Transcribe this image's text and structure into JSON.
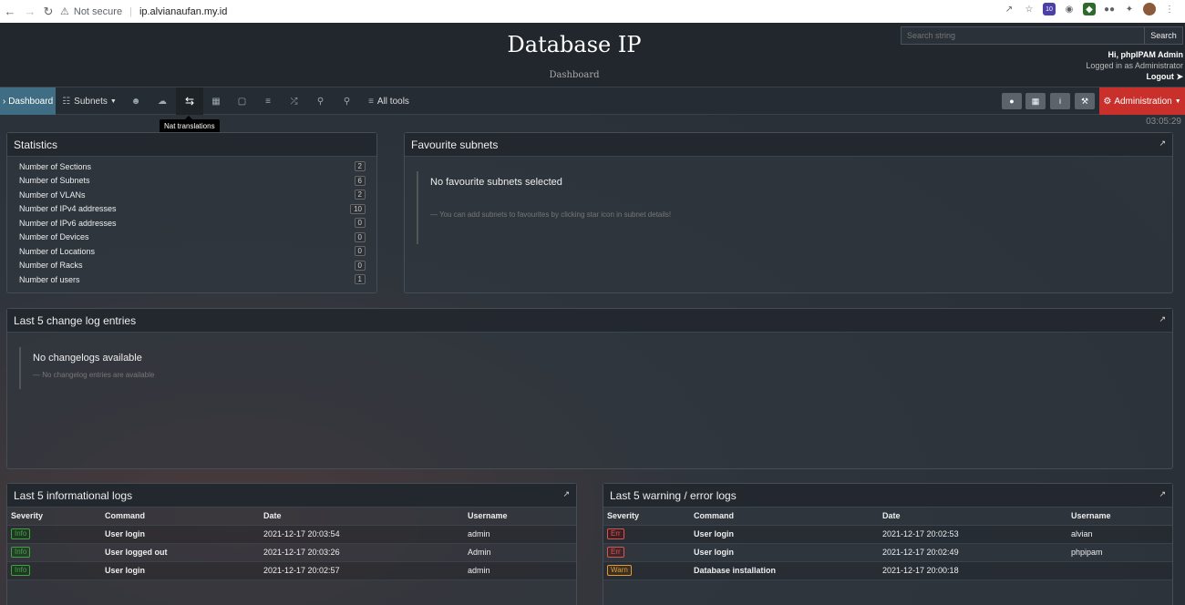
{
  "browser": {
    "security_label": "Not secure",
    "url": "ip.alvianaufan.my.id",
    "ext_badge": "10"
  },
  "header": {
    "title": "Database IP",
    "subtitle": "Dashboard",
    "search_placeholder": "Search string",
    "search_button": "Search",
    "greeting": "Hi, phpIPAM Admin",
    "logged_in_as": "Logged in as  Administrator",
    "logout": "Logout"
  },
  "nav": {
    "dashboard": "Dashboard",
    "subnets": "Subnets",
    "all_tools": "All tools",
    "administration": "Administration",
    "tooltip": "Nat translations"
  },
  "clock": "03:05:29",
  "statistics": {
    "title": "Statistics",
    "rows": [
      {
        "label": "Number of Sections",
        "value": "2"
      },
      {
        "label": "Number of Subnets",
        "value": "6"
      },
      {
        "label": "Number of VLANs",
        "value": "2"
      },
      {
        "label": "Number of IPv4 addresses",
        "value": "10"
      },
      {
        "label": "Number of IPv6 addresses",
        "value": "0"
      },
      {
        "label": "Number of Devices",
        "value": "0"
      },
      {
        "label": "Number of Locations",
        "value": "0"
      },
      {
        "label": "Number of Racks",
        "value": "0"
      },
      {
        "label": "Number of users",
        "value": "1"
      }
    ]
  },
  "favourites": {
    "title": "Favourite subnets",
    "empty_title": "No favourite subnets selected",
    "empty_sub": "— You can add subnets to favourites by clicking star icon in subnet details!"
  },
  "changelog": {
    "title": "Last 5 change log entries",
    "empty_title": "No changelogs available",
    "empty_sub": "— No changelog entries are available"
  },
  "info_logs": {
    "title": "Last 5 informational logs",
    "headers": [
      "Severity",
      "Command",
      "Date",
      "Username"
    ],
    "rows": [
      {
        "severity": "Info",
        "command": "User login",
        "date": "2021-12-17 20:03:54",
        "username": "admin"
      },
      {
        "severity": "Info",
        "command": "User logged out",
        "date": "2021-12-17 20:03:26",
        "username": "Admin"
      },
      {
        "severity": "Info",
        "command": "User login",
        "date": "2021-12-17 20:02:57",
        "username": "admin"
      }
    ]
  },
  "error_logs": {
    "title": "Last 5 warning / error logs",
    "headers": [
      "Severity",
      "Command",
      "Date",
      "Username"
    ],
    "rows": [
      {
        "severity": "Err",
        "command": "User login",
        "date": "2021-12-17 20:02:53",
        "username": "alvian"
      },
      {
        "severity": "Err",
        "command": "User login",
        "date": "2021-12-17 20:02:49",
        "username": "phpipam"
      },
      {
        "severity": "Warn",
        "command": "Database installation",
        "date": "2021-12-17 20:00:18",
        "username": ""
      }
    ]
  }
}
